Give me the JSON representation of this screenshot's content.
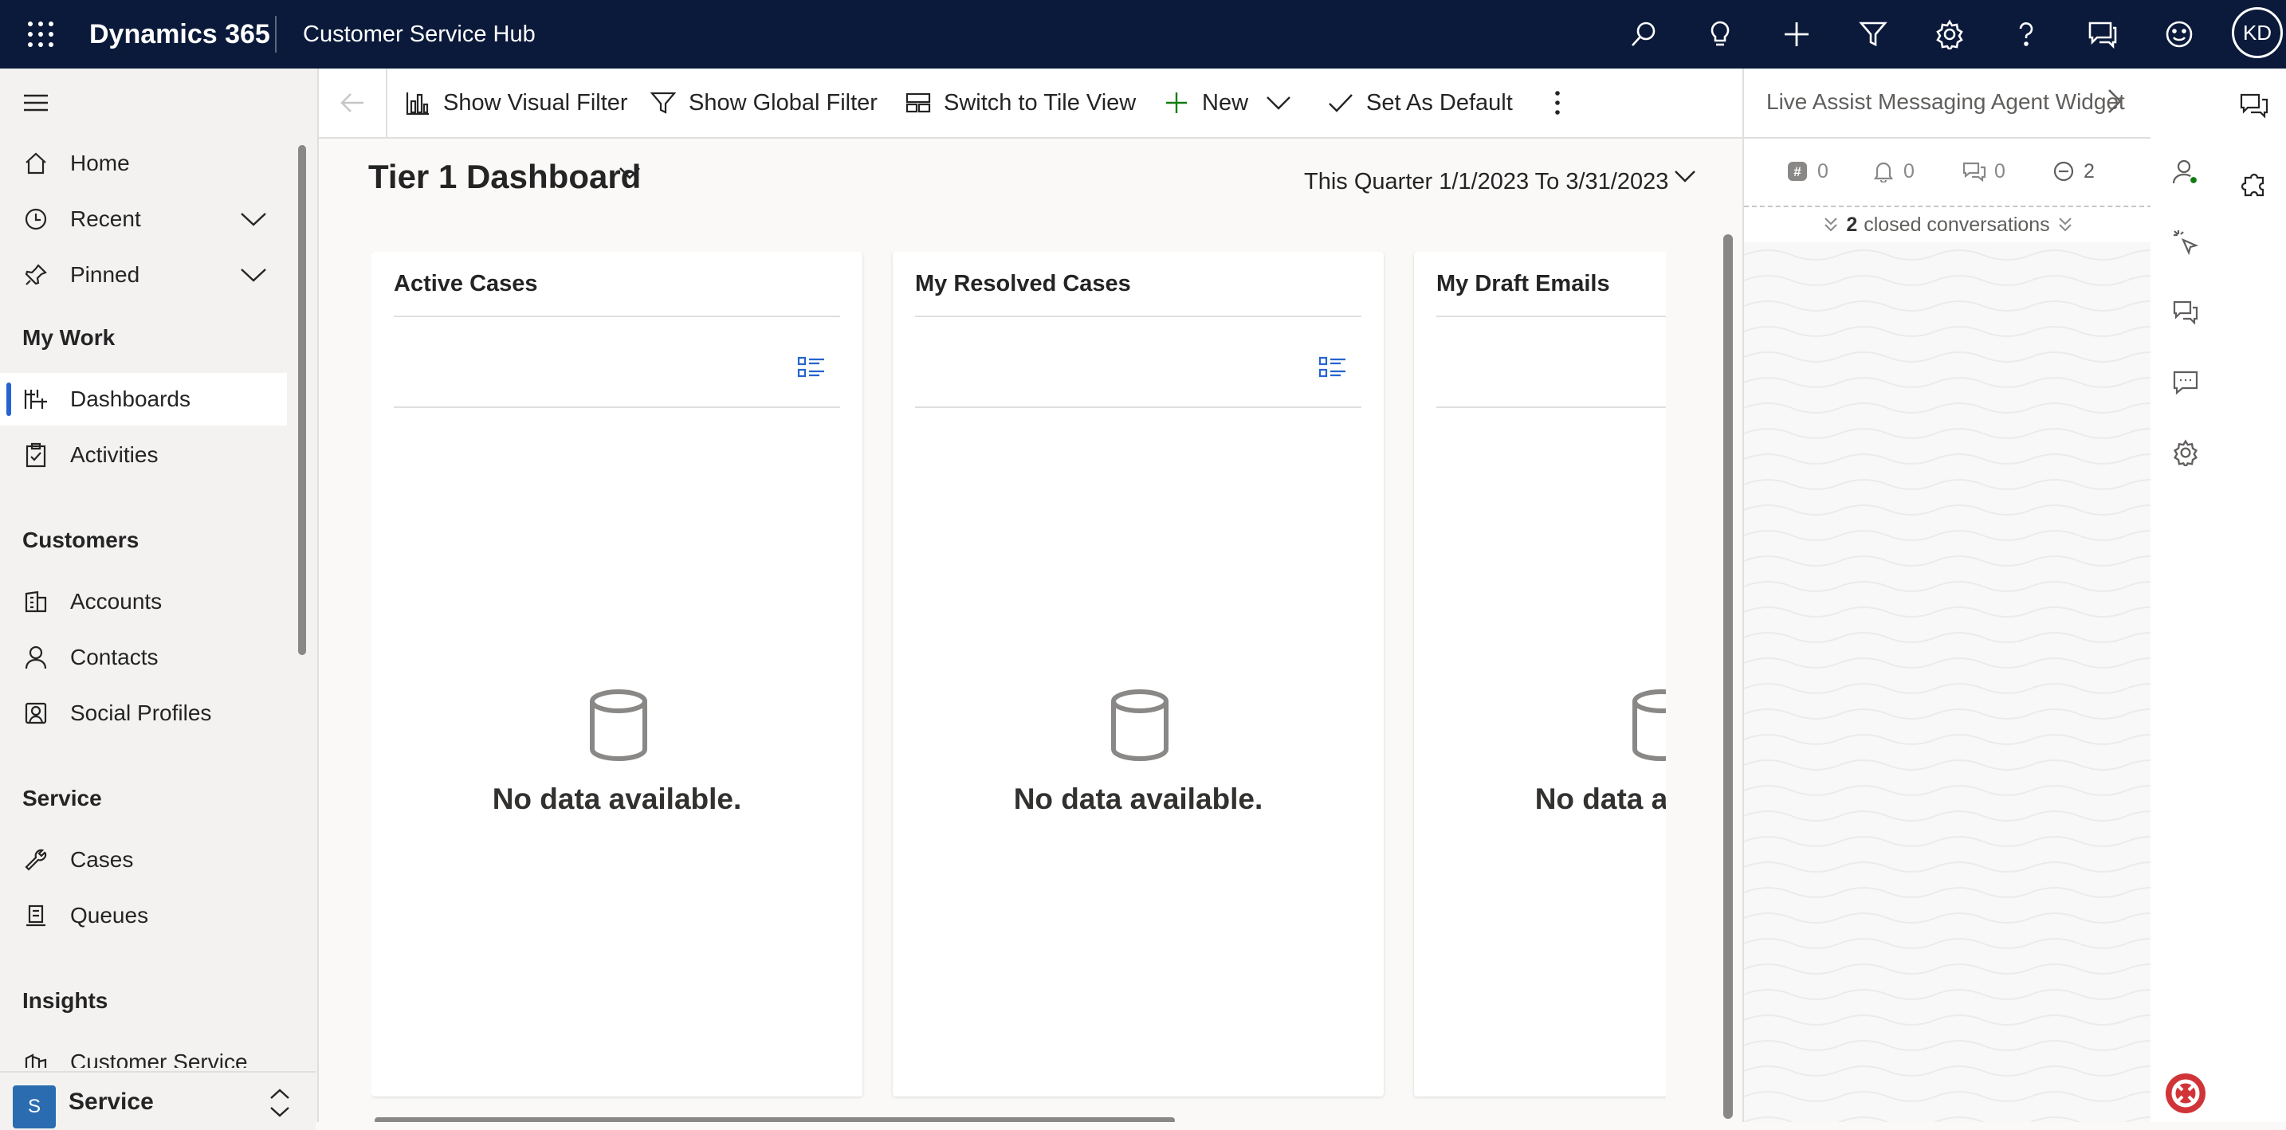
{
  "topbar": {
    "brand": "Dynamics 365",
    "app_name": "Customer Service Hub",
    "avatar_initials": "KD",
    "icons": [
      "search-icon",
      "lightbulb-icon",
      "plus-icon",
      "filter-icon",
      "gear-icon",
      "help-icon",
      "chat-icon",
      "smiley-icon"
    ],
    "background": "#0b1a3a"
  },
  "nav": {
    "items": [
      {
        "label": "Home",
        "icon": "home-icon"
      },
      {
        "label": "Recent",
        "icon": "clock-icon",
        "expandable": true
      },
      {
        "label": "Pinned",
        "icon": "pin-icon",
        "expandable": true
      }
    ],
    "groups": [
      {
        "title": "My Work",
        "items": [
          {
            "label": "Dashboards",
            "icon": "dashboard-icon",
            "selected": true
          },
          {
            "label": "Activities",
            "icon": "clipboard-icon"
          }
        ]
      },
      {
        "title": "Customers",
        "items": [
          {
            "label": "Accounts",
            "icon": "building-icon"
          },
          {
            "label": "Contacts",
            "icon": "person-icon"
          },
          {
            "label": "Social Profiles",
            "icon": "social-profile-icon"
          }
        ]
      },
      {
        "title": "Service",
        "items": [
          {
            "label": "Cases",
            "icon": "wrench-icon"
          },
          {
            "label": "Queues",
            "icon": "queue-icon"
          }
        ]
      },
      {
        "title": "Insights",
        "items": [
          {
            "label": "Customer Service",
            "icon": "insights-icon"
          }
        ]
      }
    ],
    "area": {
      "badge": "S",
      "label": "Service"
    },
    "accent": "#2564cf"
  },
  "commands": {
    "show_visual_filter": "Show Visual Filter",
    "show_global_filter": "Show Global Filter",
    "switch_tile_view": "Switch to Tile View",
    "new": "New",
    "set_default": "Set As Default"
  },
  "dashboard": {
    "title": "Tier 1 Dashboard",
    "date_filter": "This Quarter 1/1/2023 To 3/31/2023",
    "cards": [
      {
        "title": "Active Cases",
        "empty_text": "No data available."
      },
      {
        "title": "My Resolved Cases",
        "empty_text": "No data available."
      },
      {
        "title": "My Draft Emails",
        "empty_text": "No data available."
      }
    ]
  },
  "widget": {
    "title": "Live Assist Messaging Agent Widget",
    "stats": {
      "hashtag": "0",
      "notifications": "0",
      "conversations": "0",
      "closed": "2"
    },
    "closed_count": "2",
    "closed_label": "closed conversations"
  }
}
